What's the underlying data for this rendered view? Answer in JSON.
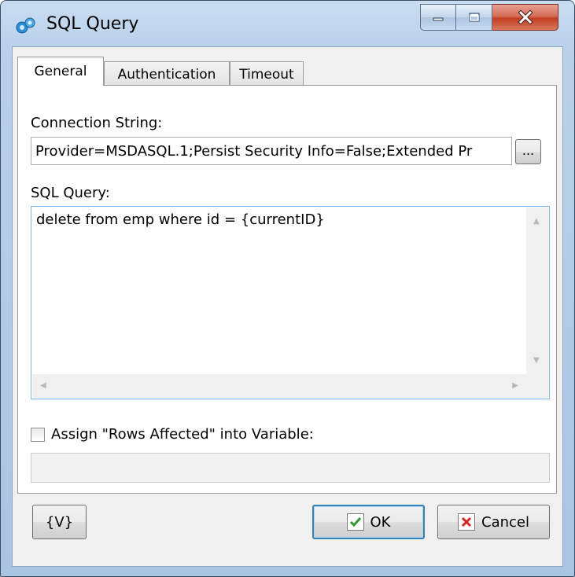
{
  "window": {
    "title": "SQL Query"
  },
  "tabs": [
    {
      "label": "General"
    },
    {
      "label": "Authentication"
    },
    {
      "label": "Timeout"
    }
  ],
  "general": {
    "connection_label": "Connection String:",
    "connection_value": "Provider=MSDASQL.1;Persist Security Info=False;Extended Pr",
    "browse_label": "...",
    "sql_label": "SQL Query:",
    "sql_value": "delete from emp where id = {currentID}",
    "assign_label": "Assign \"Rows Affected\" into Variable:",
    "assign_checked": false,
    "variable_value": ""
  },
  "buttons": {
    "variables_label": "{V}",
    "ok_label": "OK",
    "cancel_label": "Cancel"
  },
  "colors": {
    "ok_check": "#2e9a2e",
    "cancel_x": "#d32222",
    "close_button": "#c23f22"
  }
}
